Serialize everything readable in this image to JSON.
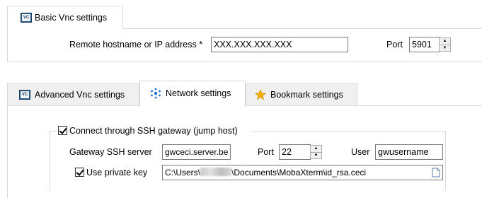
{
  "basic": {
    "tab_label": "Basic Vnc settings",
    "host_label": "Remote hostname or IP address *",
    "host_value": "XXX.XXX.XXX.XXX",
    "port_label": "Port",
    "port_value": "5901"
  },
  "tabs": [
    {
      "label": "Advanced Vnc settings",
      "icon": "vnc-icon",
      "active": false
    },
    {
      "label": "Network settings",
      "icon": "network-icon",
      "active": true
    },
    {
      "label": "Bookmark settings",
      "icon": "star-icon",
      "active": false
    }
  ],
  "network": {
    "ssh_checkbox_label": "Connect through SSH gateway (jump host)",
    "ssh_checked": true,
    "gateway_label": "Gateway SSH server",
    "gateway_value": "gwceci.server.be",
    "port_label": "Port",
    "port_value": "22",
    "user_label": "User",
    "user_value": "gwusername",
    "private_key_label": "Use private key",
    "private_key_checked": true,
    "key_path_prefix": "C:\\Users\\",
    "key_path_suffix": "\\Documents\\MobaXterm\\id_rsa.ceci"
  },
  "colors": {
    "tab_bg": "#f0f0f0",
    "border": "#d9d9d9",
    "network_dot": "#1f6fd6",
    "star": "#f2b400"
  }
}
